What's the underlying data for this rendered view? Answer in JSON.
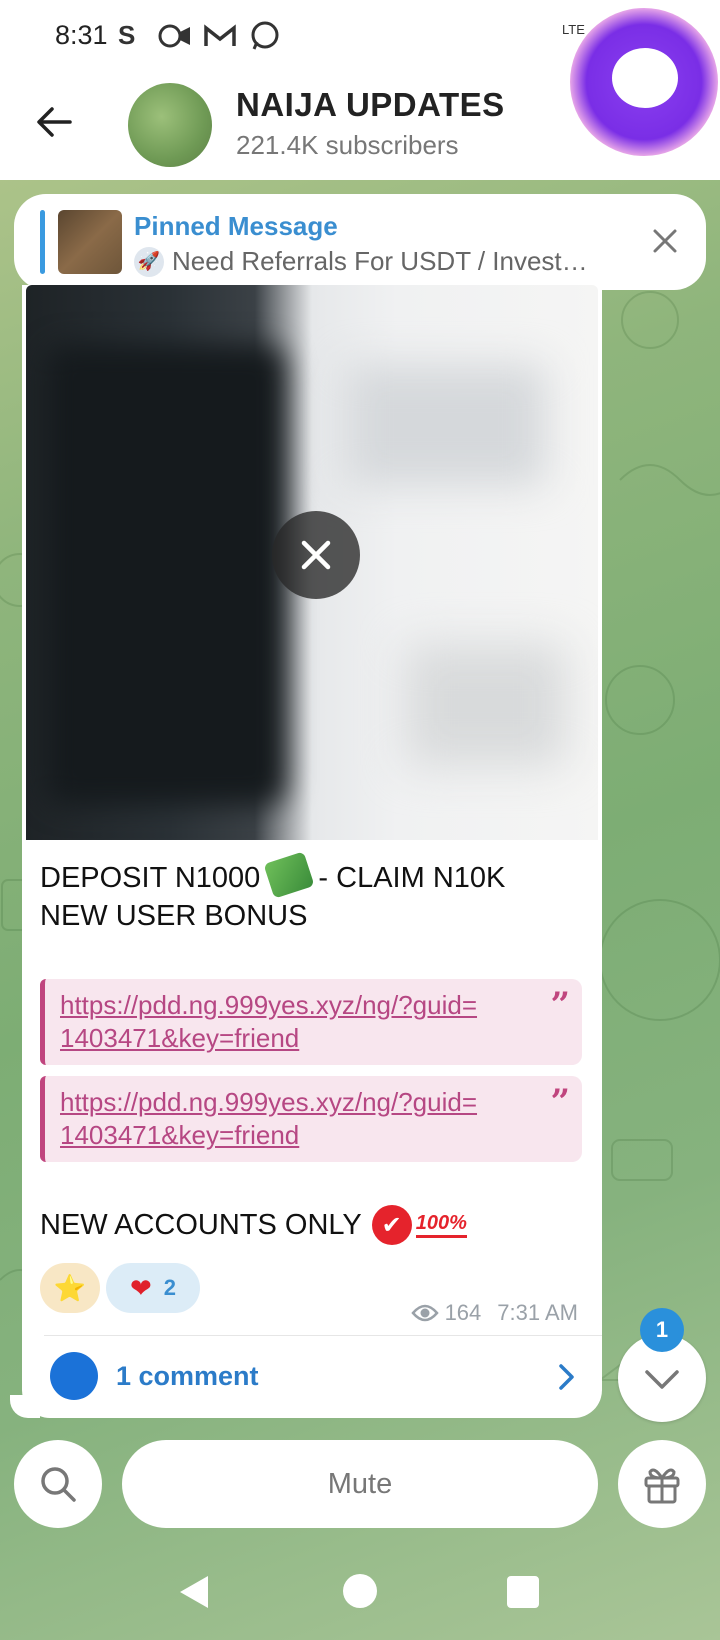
{
  "status_bar": {
    "time": "8:31",
    "net": "LTE",
    "icons": [
      "s-app-icon",
      "video-icon",
      "gmail-icon",
      "whatsapp-icon",
      "signal-icon",
      "battery-icon"
    ]
  },
  "header": {
    "title": "NAIJA UPDATES",
    "subtitle": "221.4K subscribers"
  },
  "pinned": {
    "title": "Pinned Message",
    "text": "Need Referrals For USDT / Invest…"
  },
  "message": {
    "line1": "DEPOSIT N1000",
    "line1b": "- CLAIM N10K",
    "line2": "NEW USER BONUS",
    "link1a": "https://pdd.ng.999yes.xyz/ng/?guid=",
    "link1b": "1403471&key=friend",
    "link2a": "https://pdd.ng.999yes.xyz/ng/?guid=",
    "link2b": "1403471&key=friend",
    "footer": "NEW ACCOUNTS ONLY",
    "hundred": "100%",
    "reactions": [
      {
        "emoji": "⭐",
        "count": ""
      },
      {
        "emoji": "❤",
        "count": "2"
      }
    ],
    "views": "164",
    "time": "7:31 AM",
    "comments": "1 comment"
  },
  "scroll": {
    "badge": "1"
  },
  "bottom": {
    "mute_label": "Mute"
  },
  "colors": {
    "accent": "#3a8ed0",
    "link": "#b64783",
    "quote_bg": "#f8e6ee"
  }
}
